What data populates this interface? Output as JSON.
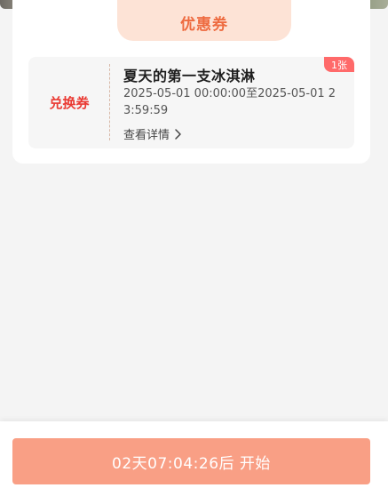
{
  "section": {
    "title": "优惠券"
  },
  "coupon": {
    "type_label": "兑换券",
    "count_badge": "1张",
    "name": "夏天的第一支冰淇淋",
    "valid_period": "2025-05-01 00:00:00至2025-05-01 23:59:59",
    "detail_link": "查看详情"
  },
  "footer": {
    "countdown_button": "02天07:04:26后 开始"
  },
  "colors": {
    "accent": "#ee6b40",
    "type_label": "#ea3a33",
    "badge_bg": "#ff6a6a",
    "button_bg": "#f99f85",
    "tab_bg": "#fde3d6"
  }
}
